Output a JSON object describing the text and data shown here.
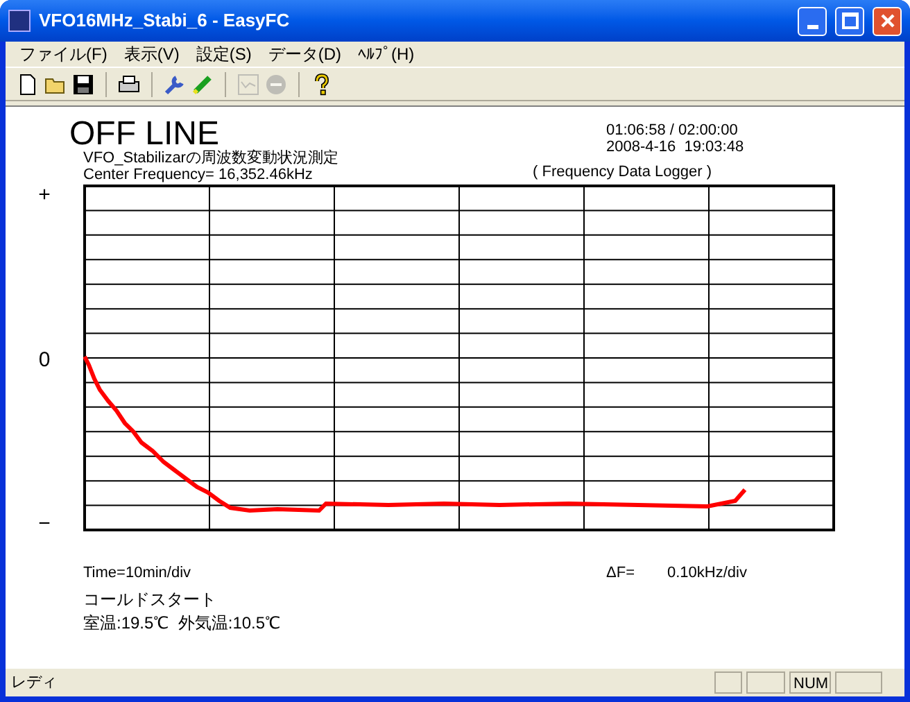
{
  "window": {
    "title": "VFO16MHz_Stabi_6 - EasyFC"
  },
  "menu": [
    "ファイル(F)",
    "表示(V)",
    "設定(S)",
    "データ(D)",
    "ﾍﾙﾌﾟ(H)"
  ],
  "toolbar": [
    [
      {
        "kind": "new",
        "disabled": false
      },
      {
        "kind": "open",
        "disabled": false
      },
      {
        "kind": "save",
        "disabled": false
      }
    ],
    [
      {
        "kind": "print",
        "disabled": false
      }
    ],
    [
      {
        "kind": "wrench",
        "disabled": false
      },
      {
        "kind": "pen",
        "disabled": false
      }
    ],
    [
      {
        "kind": "graph",
        "disabled": true
      },
      {
        "kind": "stop",
        "disabled": true
      }
    ],
    [
      {
        "kind": "help",
        "disabled": false
      }
    ]
  ],
  "chart": {
    "status": "OFF LINE",
    "title": "VFO_Stabilizarの周波数変動状況測定",
    "center_frequency": "Center Frequency= 16,352.46kHz",
    "elapsed": "01:06:58 / 02:00:00",
    "timestamp": "2008-4-16  19:03:48",
    "subtitle": "( Frequency Data Logger )",
    "y_top": "+",
    "y_mid": "0",
    "y_bottom": "−",
    "time_scale": "Time=10min/div",
    "delta_label": "ΔF=",
    "delta_value": "0.10kHz/div",
    "note": "コールドスタート",
    "temperatures": "室温:19.5℃  外気温:10.5℃"
  },
  "status_bar": {
    "text": "レディ",
    "indicator": "NUM"
  }
}
